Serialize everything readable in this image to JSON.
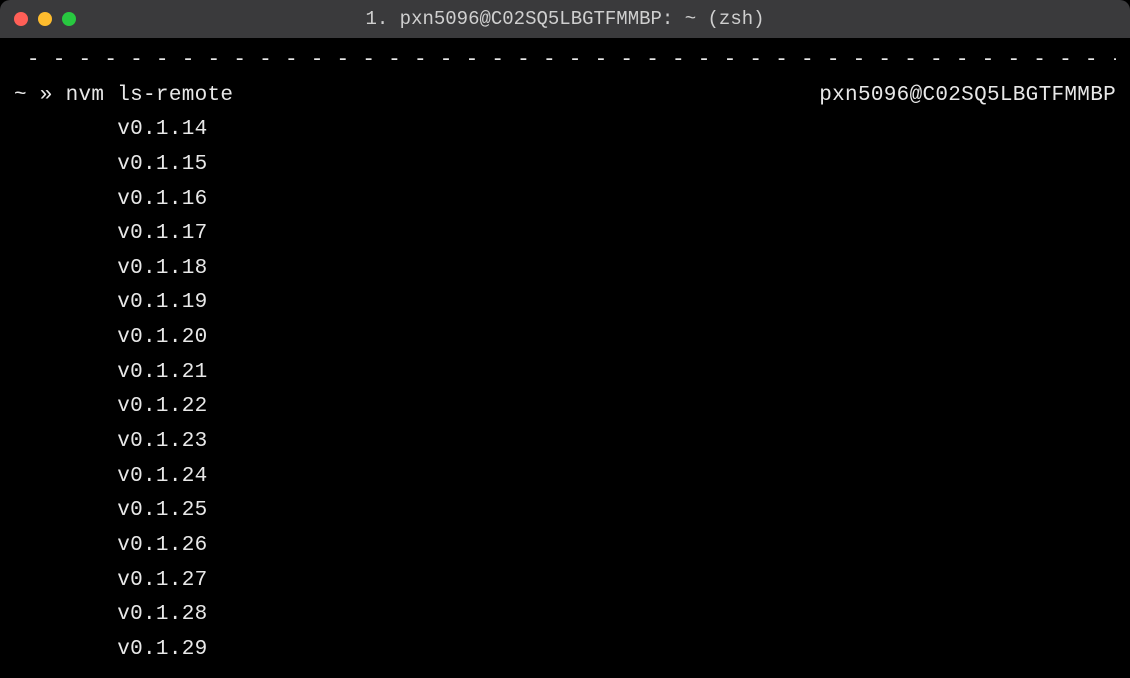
{
  "titlebar": {
    "title": "1. pxn5096@C02SQ5LBGTFMMBP: ~ (zsh)"
  },
  "divider": " - - - - - - - - - - - - - - - - - - - - - - - - - - - - - - - - - - - - - - - - - - - - - - -",
  "prompt": {
    "symbol": "~ » ",
    "command": "nvm ls-remote",
    "right_info": "pxn5096@C02SQ5LBGTFMMBP"
  },
  "output": {
    "indent": "        ",
    "versions": [
      "v0.1.14",
      "v0.1.15",
      "v0.1.16",
      "v0.1.17",
      "v0.1.18",
      "v0.1.19",
      "v0.1.20",
      "v0.1.21",
      "v0.1.22",
      "v0.1.23",
      "v0.1.24",
      "v0.1.25",
      "v0.1.26",
      "v0.1.27",
      "v0.1.28",
      "v0.1.29"
    ]
  }
}
